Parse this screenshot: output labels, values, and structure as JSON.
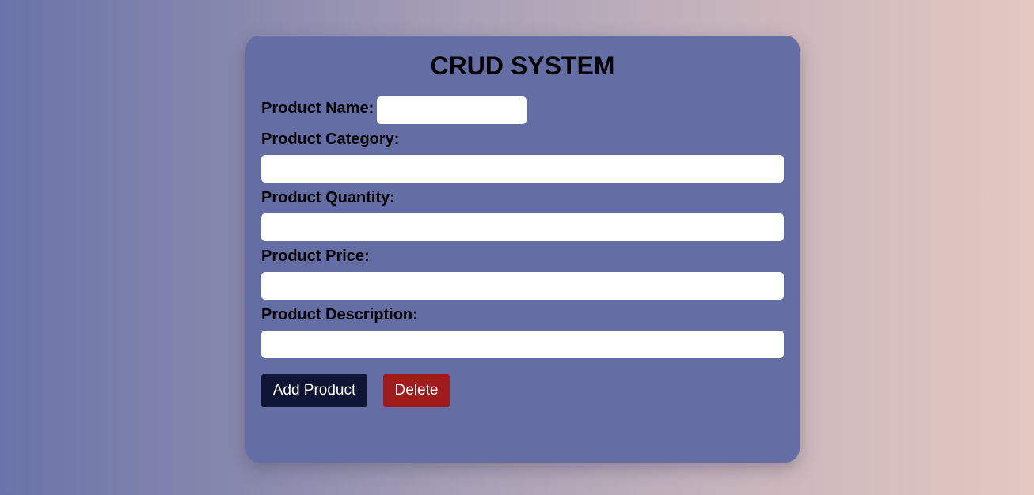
{
  "form": {
    "title": "CRUD SYSTEM",
    "name_label": "Product Name:",
    "name_value": "",
    "category_label": "Product Category:",
    "category_value": "",
    "quantity_label": "Product Quantity:",
    "quantity_value": "",
    "price_label": "Product Price:",
    "price_value": "",
    "description_label": "Product Description:",
    "description_value": "",
    "add_button": "Add Product",
    "delete_button": "Delete"
  },
  "colors": {
    "card": "#646ea5",
    "add_button": "#0f1535",
    "delete_button": "#a01c1c"
  }
}
